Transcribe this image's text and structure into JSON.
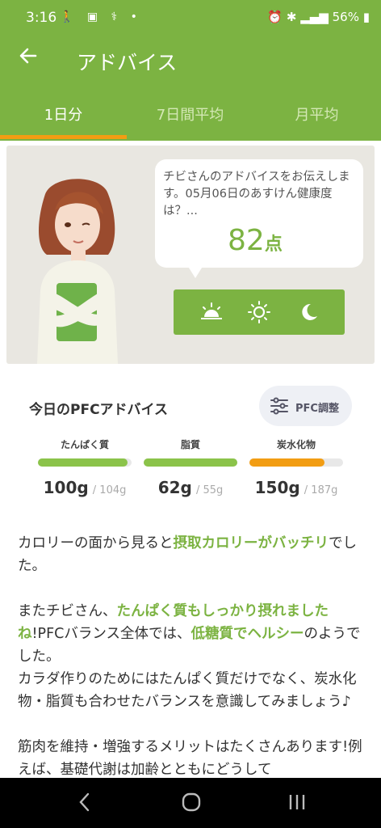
{
  "status": {
    "time": "3:16",
    "left_icons": "🚶 ▣ ⚕ •",
    "battery": "56%"
  },
  "appbar": {
    "title": "アドバイス"
  },
  "tabs": [
    {
      "label": "1日分",
      "active": true
    },
    {
      "label": "7日間平均",
      "active": false
    },
    {
      "label": "月平均",
      "active": false
    }
  ],
  "advice_bubble": {
    "message": "チビさんのアドバイスをお伝えします。05月06日のあすけん健康度は？...",
    "score": "82",
    "unit": "点"
  },
  "time_icons": [
    "sunrise-icon",
    "sun-icon",
    "moon-icon"
  ],
  "pfc": {
    "title": "今日のPFCアドバイス",
    "button_label": "PFC調整",
    "nutrients": [
      {
        "label": "たんぱく質",
        "value": "100",
        "unit": "g",
        "target": "/ 104g",
        "fill": 0.96,
        "color": "#8bc34a"
      },
      {
        "label": "脂質",
        "value": "62",
        "unit": "g",
        "target": "/ 55g",
        "fill": 1.0,
        "color": "#8bc34a"
      },
      {
        "label": "炭水化物",
        "value": "150",
        "unit": "g",
        "target": "/ 187g",
        "fill": 0.8,
        "color": "#f29d13"
      }
    ]
  },
  "advice": {
    "p1_a": "カロリーの面から見ると",
    "p1_hl": "摂取カロリーがバッチリ",
    "p1_b": "でした。",
    "p2_a": "またチビさん、",
    "p2_hl1": "たんぱく質もしっかり摂れましたね",
    "p2_b": "!PFCバランス全体では、",
    "p2_hl2": "低糖質でヘルシー",
    "p2_c": "のようでした。",
    "p2_d": "カラダ作りのためにはたんぱく質だけでなく、炭水化物・脂質も合わせたバランスを意識してみましょう♪",
    "p3": "筋肉を維持・増強するメリットはたくさんあります!例えば、基礎代謝は加齢とともにどうして"
  },
  "colors": {
    "brand": "#7cb342",
    "accent": "#f29d13"
  }
}
